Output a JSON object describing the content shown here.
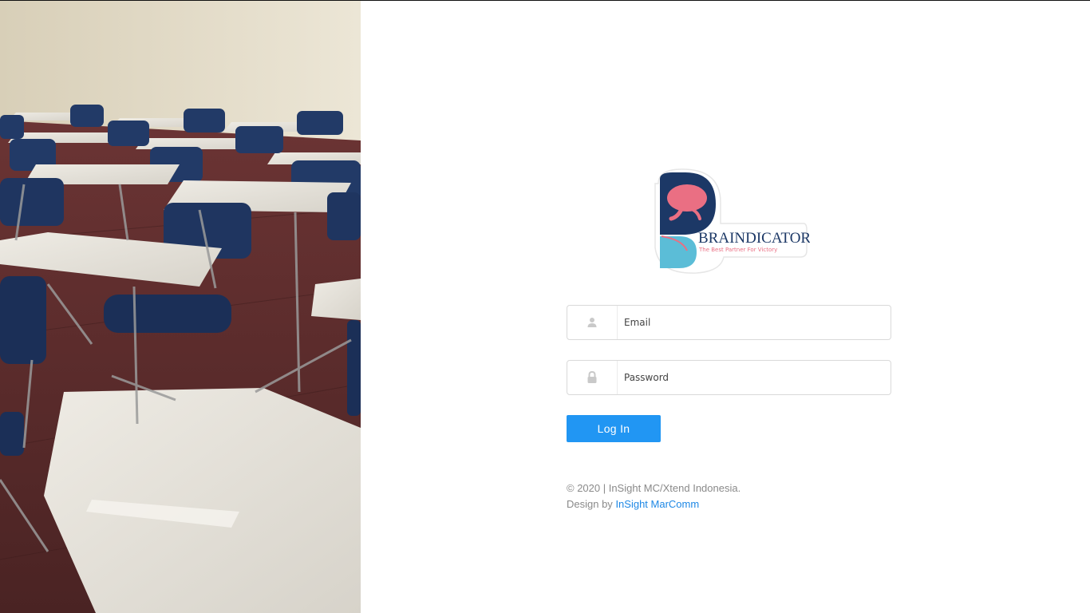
{
  "background_photo": {
    "alt": "classroom",
    "accent_floor": "#5a2a2a",
    "chair_color": "#233a66",
    "desk_color": "#e6e3dc"
  },
  "logo": {
    "brand": "BRAINDICATOR",
    "tagline": "The Best Partner For Victory",
    "colors": {
      "navy": "#1c3866",
      "pink": "#ea6f83",
      "cyan": "#5bbdd7"
    }
  },
  "login_form": {
    "email": {
      "placeholder": "Email",
      "value": "",
      "icon": "user-icon"
    },
    "password": {
      "placeholder": "Password",
      "value": "",
      "icon": "lock-icon"
    },
    "submit_label": "Log In",
    "accent": "#2196f3"
  },
  "footer": {
    "copyright": "© 2020 | InSight MC/Xtend Indonesia.",
    "design_by": "Design by",
    "design_link": "InSight MarComm"
  }
}
